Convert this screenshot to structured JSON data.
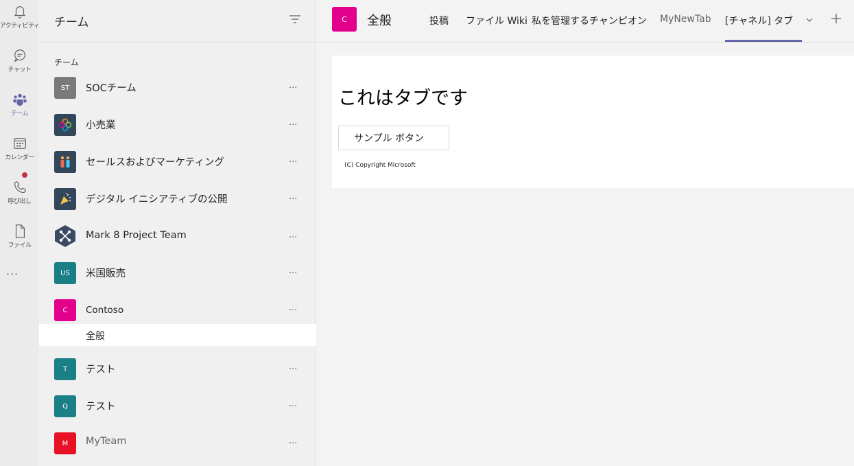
{
  "rail": {
    "items": [
      {
        "label": "アクティビティ",
        "icon": "bell-icon"
      },
      {
        "label": "チャット",
        "icon": "chat-icon"
      },
      {
        "label": "チーム",
        "icon": "teams-icon"
      },
      {
        "label": "カレンダー",
        "icon": "calendar-icon"
      },
      {
        "label": "呼び出し",
        "icon": "phone-icon"
      },
      {
        "label": "ファイル",
        "icon": "file-icon"
      }
    ],
    "more": "···"
  },
  "panel": {
    "title": "チーム",
    "section_label": "チーム",
    "teams": [
      {
        "initials": "ST",
        "name": "SOCチーム",
        "color": "#7a7a7a"
      },
      {
        "initials": "",
        "name": "小売業",
        "color": "#33475b"
      },
      {
        "initials": "",
        "name": "セールスおよびマーケティング",
        "color": "#33475b"
      },
      {
        "initials": "",
        "name": "デジタル イニシアティブの公開",
        "color": "#33475b"
      },
      {
        "initials": "",
        "name": "Mark 8 Project Team",
        "color": "#3b4a63"
      },
      {
        "initials": "US",
        "name": "米国販売",
        "color": "#1b7f86"
      },
      {
        "initials": "C",
        "name": "Contoso",
        "color": "#e3008c"
      },
      {
        "initials": "T",
        "name": "テスト",
        "color": "#1b7f86"
      },
      {
        "initials": "Q",
        "name": "テスト",
        "color": "#1b7f86"
      },
      {
        "initials": "M",
        "name": "MyTeam",
        "color": "#e81123"
      }
    ],
    "selected_channel": "全般",
    "more": "···"
  },
  "header": {
    "avatar": "C",
    "channel_title": "全般",
    "tabs": [
      "投稿",
      "ファイル Wiki",
      "私を管理するチャンピオン",
      "MyNewTab",
      "[チャネル] タブ"
    ],
    "active_tab": "[チャネル] タブ",
    "accent": "#6264a7"
  },
  "content": {
    "heading": "これはタブです",
    "button": "サンプル ボタン",
    "copyright": "(C) Copyright Microsoft"
  }
}
